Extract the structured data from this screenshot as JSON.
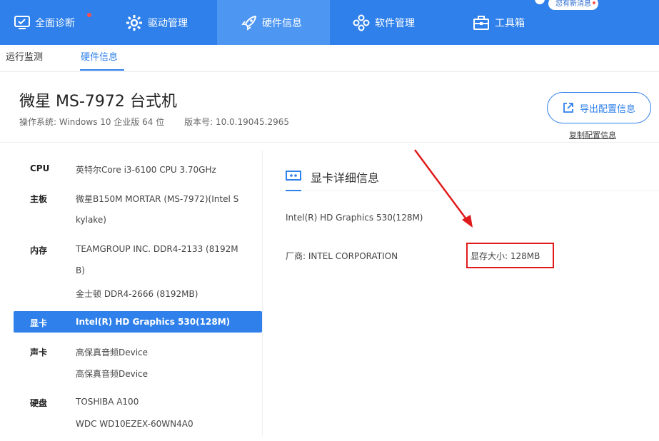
{
  "top_nav": {
    "tabs": [
      {
        "label": "全面诊断",
        "icon": "monitor-check-icon",
        "has_dot": true
      },
      {
        "label": "驱动管理",
        "icon": "gear-icon"
      },
      {
        "label": "硬件信息",
        "icon": "rocket-icon",
        "active": true
      },
      {
        "label": "软件管理",
        "icon": "apps-icon"
      },
      {
        "label": "工具箱",
        "icon": "toolbox-icon"
      }
    ],
    "message_badge": "您有新消息"
  },
  "sub_tabs": [
    {
      "label": "运行监测"
    },
    {
      "label": "硬件信息",
      "active": true
    }
  ],
  "header": {
    "title": "微星 MS-7972 台式机",
    "os_label": "操作系统:",
    "os_value": "Windows 10 企业版 64 位",
    "version_label": "版本号:",
    "version_value": "10.0.19045.2965",
    "export_button": "导出配置信息",
    "copy_link": "复制配置信息"
  },
  "hardware_list": [
    {
      "label": "CPU",
      "values": [
        "英特尔Core i3-6100 CPU 3.70GHz"
      ]
    },
    {
      "label": "主板",
      "values": [
        "微星B150M MORTAR (MS-7972)(Intel S",
        "kylake)"
      ]
    },
    {
      "label": "内存",
      "values": [
        "TEAMGROUP INC. DDR4-2133 (8192M",
        "B)",
        "金士顿 DDR4-2666 (8192MB)"
      ]
    },
    {
      "label": "显卡",
      "values": [
        "Intel(R) HD Graphics 530(128M)"
      ],
      "selected": true
    },
    {
      "label": "声卡",
      "values": [
        "高保真音频Device",
        "高保真音频Device"
      ]
    },
    {
      "label": "硬盘",
      "values": [
        "TOSHIBA A100",
        "WDC WD10EZEX-60WN4A0"
      ]
    }
  ],
  "gpu_detail": {
    "heading": "显卡详细信息",
    "name": "Intel(R) HD Graphics 530(128M)",
    "vendor_label": "厂商:",
    "vendor_value": "INTEL CORPORATION",
    "vram_label": "显存大小:",
    "vram_value": "128MB"
  },
  "colors": {
    "primary": "#2f80ea",
    "active_tab": "#4d96f2",
    "highlight_red": "#e01b1b"
  }
}
